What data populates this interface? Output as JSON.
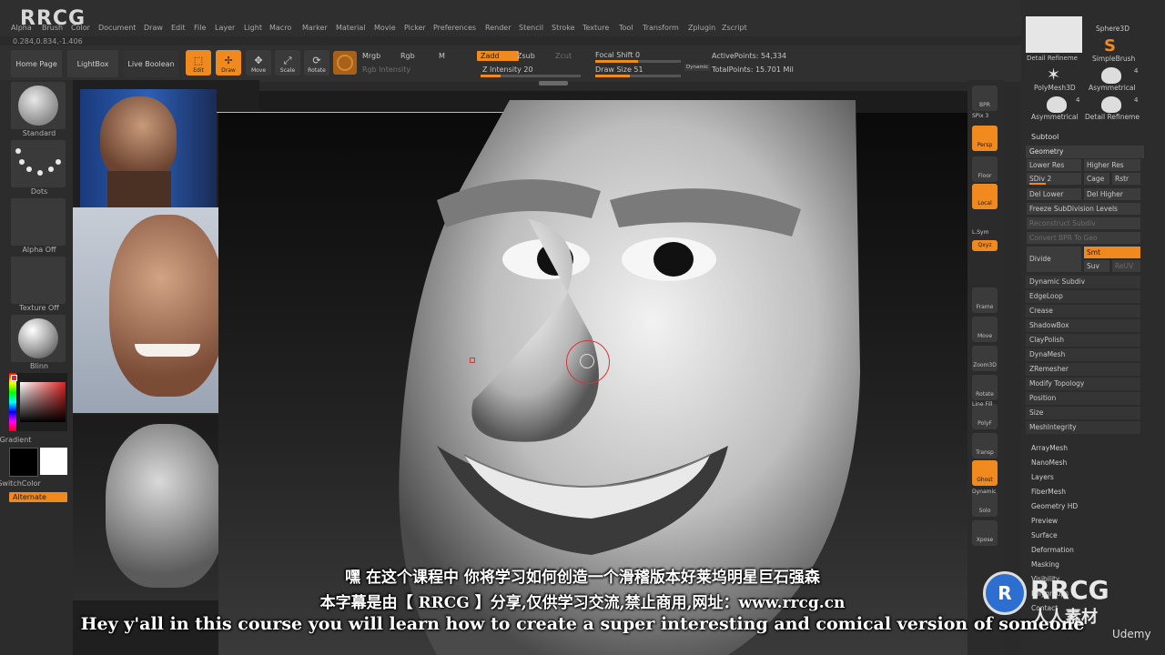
{
  "watermark_logo": "RRCG",
  "menu": [
    "Alpha",
    "Brush",
    "Color",
    "Document",
    "Draw",
    "Edit",
    "File",
    "Layer",
    "Light",
    "Macro",
    "Marker",
    "Material",
    "Movie",
    "Picker",
    "Preferences",
    "Render",
    "Stencil",
    "Stroke",
    "Texture",
    "Tool",
    "Transform",
    "Zplugin",
    "Zscript"
  ],
  "coords": "0.284,0.834,-1.406",
  "shelf": {
    "home_page": "Home Page",
    "lightbox": "LightBox",
    "live_boolean": "Live Boolean",
    "tools": [
      "Edit",
      "Draw",
      "Move",
      "Scale",
      "Rotate"
    ]
  },
  "draw_options": {
    "mrgb": "Mrgb",
    "rgb": "Rgb",
    "m": "M",
    "rgb_intensity": "Rgb Intensity",
    "zadd": "Zadd",
    "zsub": "Zsub",
    "zcut": "Zcut",
    "z_intensity": "Z Intensity 20",
    "focal_shift": "Focal Shift 0",
    "draw_size": "Draw Size 51",
    "dynamic": "Dynamic",
    "active_points": "ActivePoints: 54,334",
    "total_points": "TotalPoints: 15.701 Mil",
    "z_intensity_level": 0.2,
    "draw_size_level": 0.4
  },
  "left_tray": {
    "standard": "Standard",
    "dots": "Dots",
    "alpha_off": "Alpha Off",
    "texture_off": "Texture Off",
    "blinn": "Blinn",
    "gradient": "Gradient",
    "switch_color": "SwitchColor",
    "alternate": "Alternate"
  },
  "right_column": [
    "BPR",
    "SPix 3",
    "Persp",
    "Floor",
    "Local",
    "L.Sym",
    "Qxyz",
    "Frame",
    "Move",
    "Zoom3D",
    "Rotate",
    "Line Fill",
    "PolyF",
    "Transp",
    "Ghost",
    "Dynamic",
    "Solo",
    "Xpose"
  ],
  "tool_tiles": [
    "Detail Refineme",
    "Sphere3D",
    "SimpleBrush",
    "PolyMesh3D",
    "Asymmetrical",
    "Asymmetrical",
    "Detail Refineme"
  ],
  "tool_counts": [
    "4",
    "4",
    "4"
  ],
  "subtool_header": "Subtool",
  "geometry": {
    "title": "Geometry",
    "lower_res": "Lower Res",
    "higher_res": "Higher Res",
    "sdiv": "SDiv 2",
    "cage": "Cage",
    "rstr": "Rstr",
    "del_lower": "Del Lower",
    "del_higher": "Del Higher",
    "freeze": "Freeze SubDivision Levels",
    "reconstruct": "Reconstruct Subdiv",
    "convert_bpr": "Convert BPR To Geo",
    "divide": "Divide",
    "smt": "Smt",
    "suv": "Suv",
    "reuv": "ReUV",
    "items": [
      "Dynamic Subdiv",
      "EdgeLoop",
      "Crease",
      "ShadowBox",
      "ClayPolish",
      "DynaMesh",
      "ZRemesher",
      "Modify Topology",
      "Position",
      "Size",
      "MeshIntegrity"
    ]
  },
  "tool_sections": [
    "ArrayMesh",
    "NanoMesh",
    "Layers",
    "FiberMesh",
    "Geometry HD",
    "Preview",
    "Surface",
    "Deformation",
    "Masking",
    "Visibility",
    "Polygroups",
    "Contact"
  ],
  "subtitles": {
    "zh": "嘿 在这个课程中 你将学习如何创造一个滑稽版本好莱坞明星巨石强森",
    "credit": "本字幕是由【 RRCG 】分享,仅供学习交流,禁止商用,网址：www.rrcg.cn",
    "en": "Hey y'all in this course you will learn how to create a super interesting and comical version of someone"
  },
  "brand": {
    "rrcg": "RRCG",
    "rrsc": "人人素材",
    "udemy": "Udemy"
  },
  "colors": {
    "accent": "#f08a1e"
  }
}
